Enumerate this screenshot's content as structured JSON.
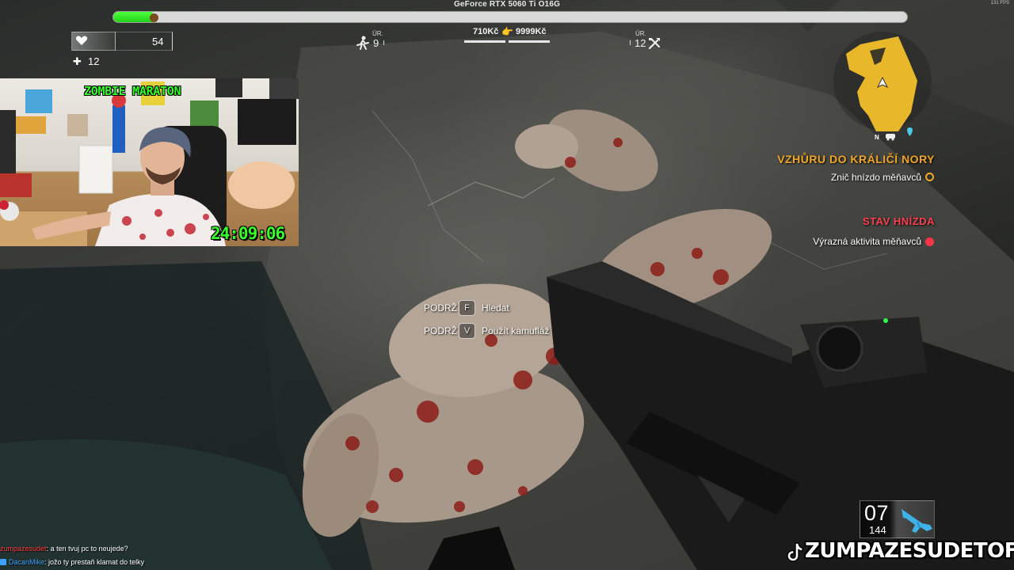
{
  "overlay": {
    "gpu_label": "GeForce RTX 5060 Ti O16G",
    "fps_label": "131 FPS"
  },
  "player": {
    "health_fraction": 0.05,
    "stamina_value": "54",
    "medkit_count": "12"
  },
  "stream": {
    "title": "ZOMBIE MARATON",
    "timer": "24:09:06",
    "watermark": "ZUMPAZESUDETOFC"
  },
  "hud_top": {
    "zombie_level_label": "ÚR.",
    "zombie_level": "9",
    "money_current": "710Kč",
    "money_max": "9999Kč",
    "craft_level_label": "ÚR.",
    "craft_level": "12"
  },
  "minimap": {
    "north_label": "N",
    "highlight_color": "#e8b82a"
  },
  "quest": {
    "title": "VZHŮRU DO KRÁLIČÍ NORY",
    "objective": "Znič hnízdo měňavců",
    "nest_title": "STAV HNÍZDA",
    "nest_status": "Výrazná aktivita měňavců",
    "accent_color": "#f2a72a",
    "alert_color": "#ff3449"
  },
  "prompts": [
    {
      "hold": "PODRŽ",
      "key": "F",
      "action": "Hledat"
    },
    {
      "hold": "PODRŽ",
      "key": "V",
      "action": "Použít kamufláž"
    }
  ],
  "ammo": {
    "magazine": "07",
    "reserve": "144"
  },
  "chat": [
    {
      "user": "zumpazesudet",
      "message": "a ten tvuj pc to neujede?"
    },
    {
      "user": "DacanMike",
      "message": "jožo ty prestaň klamat do telky"
    }
  ]
}
